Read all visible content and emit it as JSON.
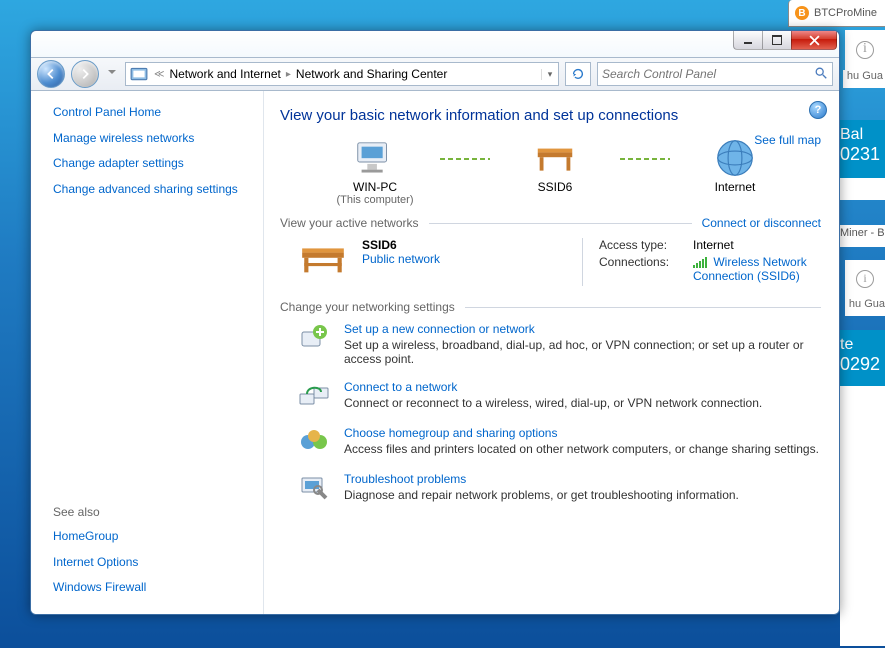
{
  "bg": {
    "tab_label": "BTCProMine",
    "gua": "hu Gua",
    "bal_label": "Bal",
    "bal_value": "0231",
    "miner": "Miner - B",
    "te_label": "te",
    "te_value": "0292"
  },
  "breadcrumb": {
    "level1": "Network and Internet",
    "level2": "Network and Sharing Center"
  },
  "search": {
    "placeholder": "Search Control Panel"
  },
  "sidebar": {
    "home": "Control Panel Home",
    "items": [
      {
        "label": "Manage wireless networks",
        "highlight": true
      },
      {
        "label": "Change adapter settings",
        "highlight": false
      },
      {
        "label": "Change advanced sharing settings",
        "highlight": false
      }
    ],
    "see_also_heading": "See also",
    "see_also": [
      {
        "label": "HomeGroup"
      },
      {
        "label": "Internet Options"
      },
      {
        "label": "Windows Firewall"
      }
    ]
  },
  "main": {
    "title": "View your basic network information and set up connections",
    "fullmap": "See full map",
    "nodes": {
      "pc": {
        "label": "WIN-PC",
        "sub": "(This computer)"
      },
      "mid": {
        "label": "SSID6"
      },
      "net": {
        "label": "Internet"
      }
    },
    "active_header": "View your active networks",
    "connect_link": "Connect or disconnect",
    "active": {
      "name": "SSID6",
      "type": "Public network",
      "access_label": "Access type:",
      "access_value": "Internet",
      "conn_label": "Connections:",
      "conn_value": "Wireless Network Connection (SSID6)"
    },
    "settings_header": "Change your networking settings",
    "settings": [
      {
        "title": "Set up a new connection or network",
        "desc": "Set up a wireless, broadband, dial-up, ad hoc, or VPN connection; or set up a router or access point."
      },
      {
        "title": "Connect to a network",
        "desc": "Connect or reconnect to a wireless, wired, dial-up, or VPN network connection."
      },
      {
        "title": "Choose homegroup and sharing options",
        "desc": "Access files and printers located on other network computers, or change sharing settings."
      },
      {
        "title": "Troubleshoot problems",
        "desc": "Diagnose and repair network problems, or get troubleshooting information."
      }
    ]
  }
}
